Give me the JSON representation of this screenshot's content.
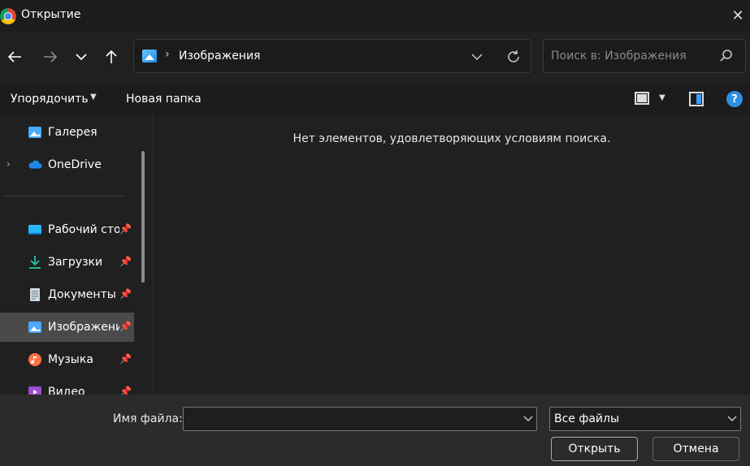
{
  "window": {
    "title": "Открытие",
    "close_icon": "close-icon"
  },
  "nav": {
    "back_icon": "arrow-left-icon",
    "forward_icon": "arrow-right-icon",
    "recent_icon": "chevron-down-icon",
    "up_icon": "arrow-up-icon"
  },
  "address": {
    "separator": "›",
    "path": "Изображения",
    "dropdown_icon": "chevron-down-icon",
    "refresh_icon": "refresh-icon"
  },
  "search": {
    "placeholder": "Поиск в: Изображения",
    "value": ""
  },
  "toolbar": {
    "organize_label": "Упорядочить",
    "new_folder_label": "Новая папка"
  },
  "sidebar": {
    "items": [
      {
        "label": "Галерея",
        "icon": "gallery-icon",
        "pinned": false
      },
      {
        "label": "OneDrive",
        "icon": "cloud-icon",
        "pinned": false
      },
      {
        "label": "Рабочий стол",
        "icon": "desktop-icon",
        "pinned": true
      },
      {
        "label": "Загрузки",
        "icon": "download-icon",
        "pinned": true
      },
      {
        "label": "Документы",
        "icon": "document-icon",
        "pinned": true
      },
      {
        "label": "Изображения",
        "icon": "pictures-icon",
        "pinned": true,
        "selected": true
      },
      {
        "label": "Музыка",
        "icon": "music-icon",
        "pinned": true
      },
      {
        "label": "Видео",
        "icon": "video-icon",
        "pinned": true
      }
    ]
  },
  "main": {
    "empty_message": "Нет элементов, удовлетворяющих условиям поиска."
  },
  "footer": {
    "filename_label": "Имя файла:",
    "filename_value": "",
    "filetype_label": "Все файлы",
    "open_label": "Открыть",
    "cancel_label": "Отмена"
  }
}
